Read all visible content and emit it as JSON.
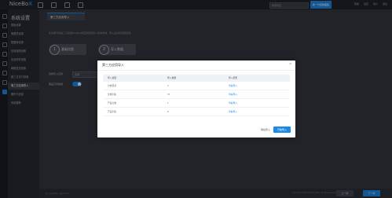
{
  "header": {
    "logo_text": "NiceBo",
    "logo_accent": "X",
    "search_placeholder": "搜索项目",
    "primary_button": "新一代控制面板",
    "right_links": [
      "帮助",
      "设置",
      "用户",
      "退出"
    ]
  },
  "sidebar": {
    "title": "系统设置",
    "items": [
      "基础设置",
      "管理员设置",
      "数据库设置",
      "目录权限设置",
      "安全防护设置",
      "邮箱发送设置",
      "第三方支付设置",
      "第三方应用导入",
      "备份与还原",
      "系统更新"
    ],
    "active_index": 7
  },
  "main": {
    "tab_label": "第三方应用导入",
    "description": "此功能可将第三方应用NiceBox的应用配置导入到本系统，导入后请检查配置项。",
    "steps": [
      {
        "num": "1",
        "label": "基础信息"
      },
      {
        "num": "2",
        "label": "导入数据"
      }
    ],
    "form": {
      "field_label": "选择导入应用",
      "field_value": "选择",
      "toggle_label": "覆盖已有数据"
    }
  },
  "footer": {
    "left_text": "第三方应用导入 版本 1.0.0",
    "copyright": "Copyright ©2016-2020 NiceBox, All rights reserved.",
    "buttons": [
      "上一步",
      "下一步"
    ]
  },
  "modal": {
    "title": "第三方应用导入",
    "close_label": "×",
    "columns": [
      "导入类型",
      "导入数量",
      "导入结果"
    ],
    "rows": [
      {
        "type": "分类目录",
        "count": "4",
        "result": "查看导入"
      },
      {
        "type": "文章列表",
        "count": "73",
        "result": "查看导入"
      },
      {
        "type": "产品分类",
        "count": "1",
        "result": "查看导入"
      },
      {
        "type": "产品列表",
        "count": "6",
        "result": "查看导入"
      }
    ],
    "cancel_label": "稍后导入",
    "confirm_label": "开始导入"
  },
  "colors": {
    "accent": "#1e88e5",
    "background": "#2d3138"
  }
}
